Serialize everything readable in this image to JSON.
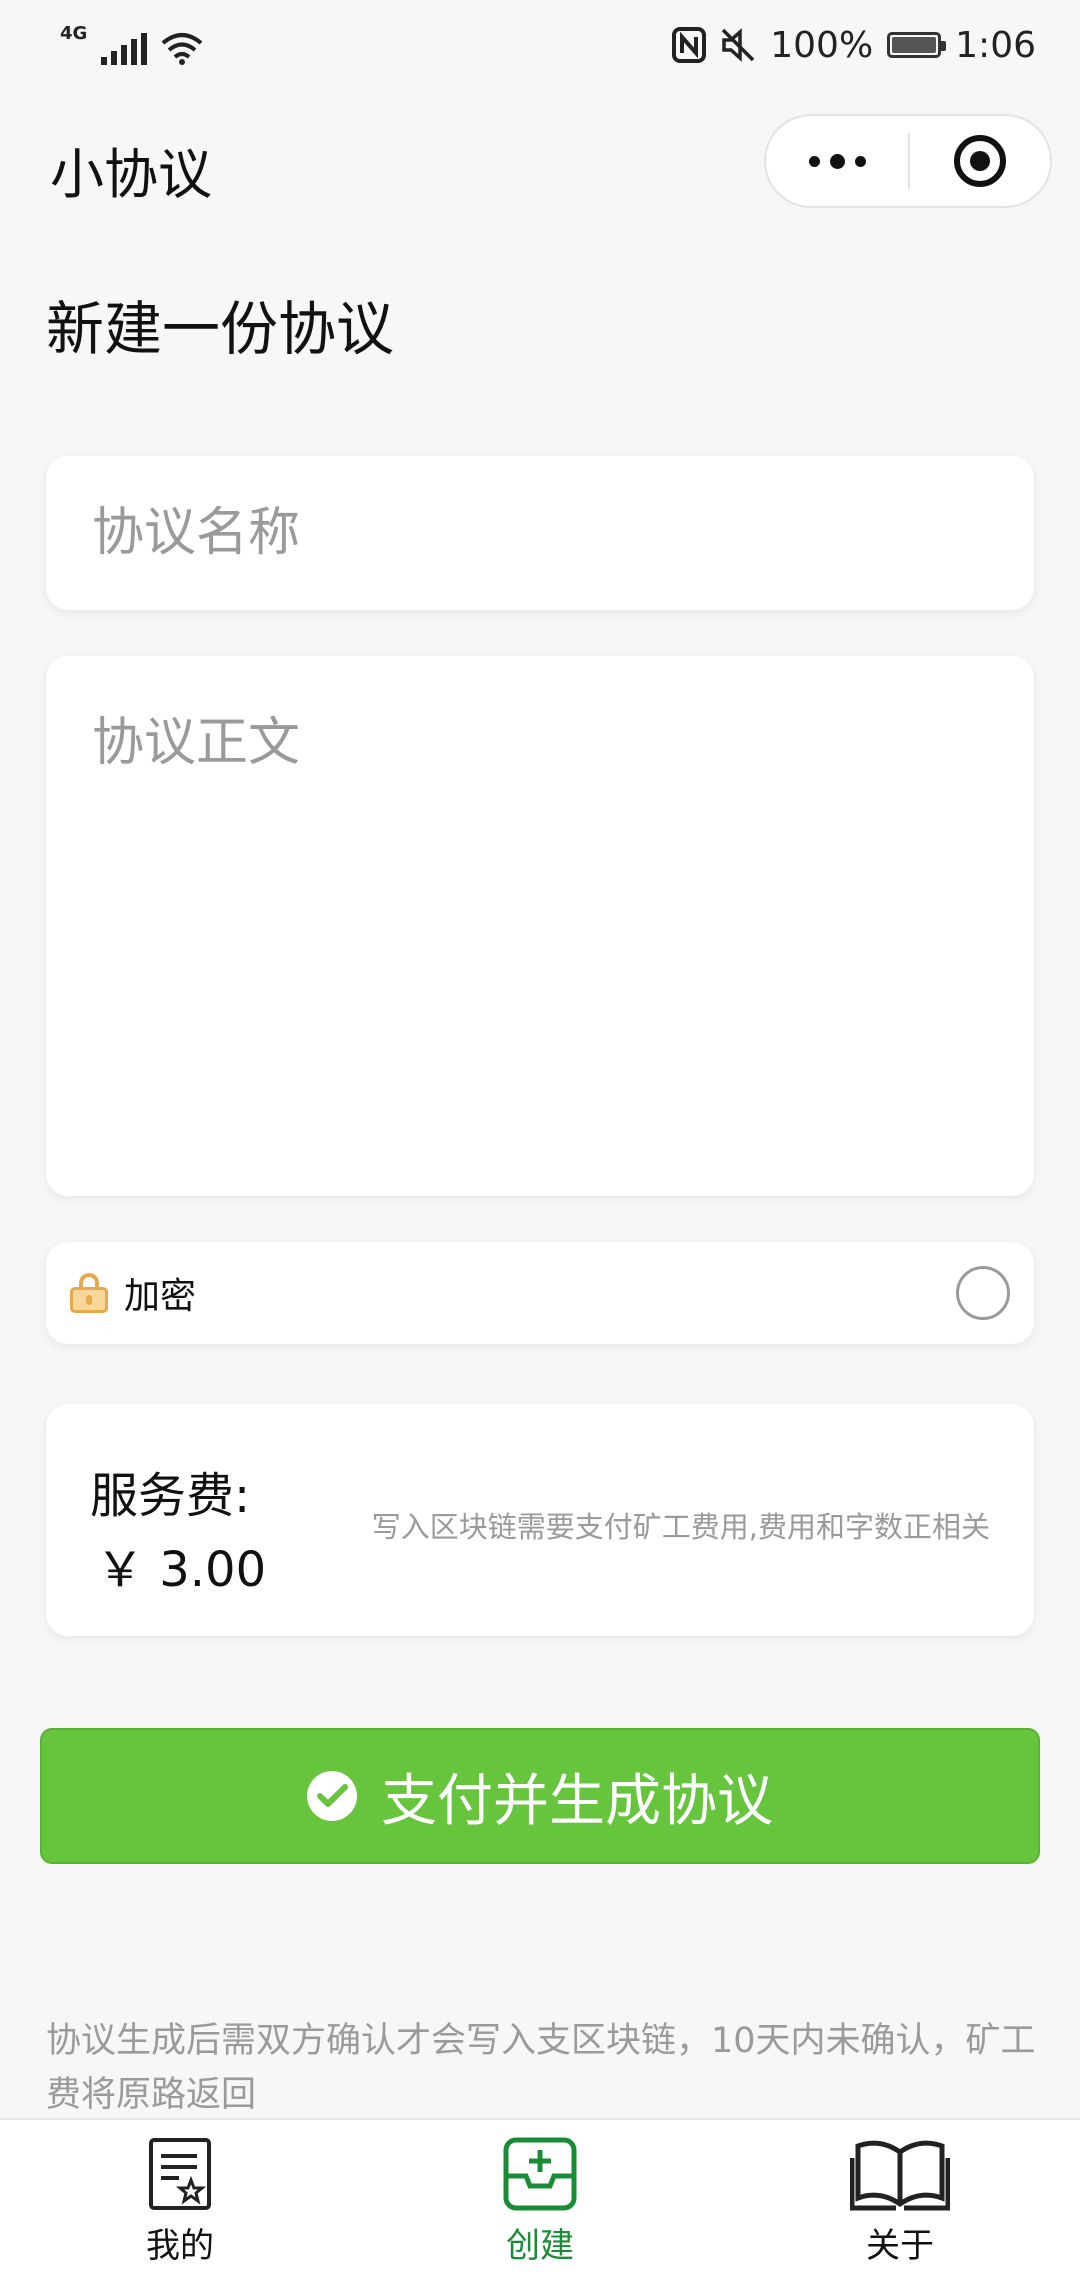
{
  "status_bar": {
    "network": "4G",
    "battery": "100%",
    "time": "1:06"
  },
  "navbar": {
    "title": "小协议"
  },
  "page": {
    "title": "新建一份协议"
  },
  "form": {
    "name_placeholder": "协议名称",
    "name_value": "",
    "body_placeholder": "协议正文",
    "body_value": "",
    "encrypt_label": "加密",
    "encrypt_checked": false
  },
  "fee": {
    "label": "服务费:",
    "amount": "￥ 3.00",
    "note": "写入区块链需要支付矿工费用,费用和字数正相关"
  },
  "pay_button": {
    "label": "支付并生成协议"
  },
  "footer_note": "协议生成后需双方确认才会写入支区块链，10天内未确认，矿工费将原路返回",
  "tabbar": {
    "tabs": [
      {
        "label": "我的",
        "icon": "document-star-icon",
        "active": false
      },
      {
        "label": "创建",
        "icon": "add-tray-icon",
        "active": true
      },
      {
        "label": "关于",
        "icon": "book-icon",
        "active": false
      }
    ]
  },
  "colors": {
    "accent_green": "#66c43d",
    "tab_active": "#1a8c35",
    "placeholder": "#9a9a9a",
    "background": "#f7f7f7"
  }
}
